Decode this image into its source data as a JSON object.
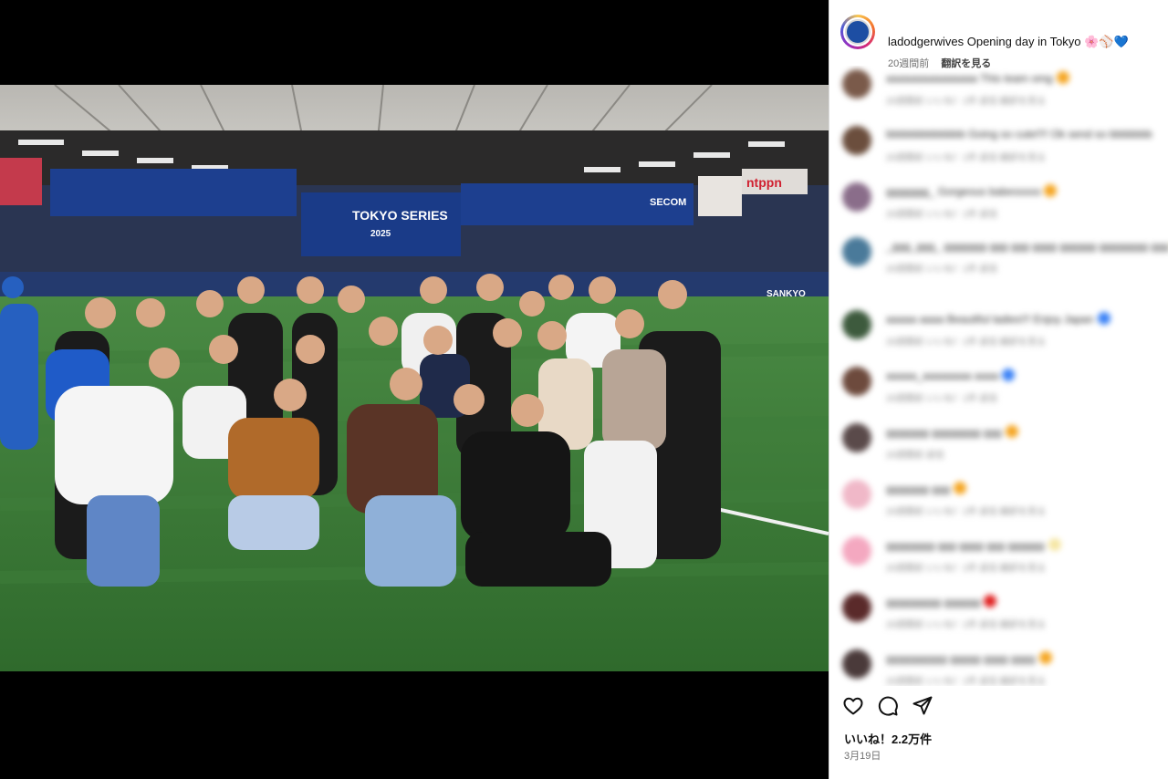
{
  "post": {
    "username": "ladodgerwives",
    "caption": "Opening day in Tokyo",
    "caption_emojis": "🌸⚾💙",
    "time_ago": "20週間前",
    "translate_label": "翻訳を見る"
  },
  "photo": {
    "alt_description_icon": "team-group-photo",
    "sponsor_boards": [
      "ntppn",
      "SECOM",
      "SANKYO"
    ],
    "scoreboard_title": "TOKYO SERIES",
    "scoreboard_year": "2025"
  },
  "comments": [
    {
      "text": "aaaaaaaaaaaaaaa This team omg",
      "sub": "20週間前   いいね！1件   返信   翻訳を見る",
      "color": "#7a5a4a",
      "emoji": "#f5a623"
    },
    {
      "text": "bbbbbbbbbbbbb Going so cute!!!! Ok send so bbbbbbb",
      "sub": "20週間前   いいね！1件   返信   翻訳を見る",
      "color": "#6b4e3d",
      "emoji": ""
    },
    {
      "text": "ggggggg_ Gorgeous babesssss",
      "sub": "20週間前   いいね！1件   返信",
      "color": "#8a6d8a",
      "emoji": "#f5a623"
    },
    {
      "text": "_ggg_ggg_ ggggggg ggg ggg gggg gggggg gggggggg ggg",
      "sub": "20週間前   いいね！1件   返信",
      "color": "#4a7a9a",
      "emoji": "#f5d623"
    },
    {
      "text": "aaaaa aaaa Beautiful ladies!!!   Enjoy Japan",
      "sub": "20週間前   いいね！1件   返信   翻訳を見る",
      "color": "#3d5a3d",
      "emoji": "#3b82f6"
    },
    {
      "text": "aaaaa_aaaaaaaa aaaa",
      "sub": "20週間前   いいね！1件   返信",
      "color": "#6d4a3d",
      "emoji": "#3b82f6"
    },
    {
      "text": "ggggggg gggggggg ggg",
      "sub": "20週間前   返信",
      "color": "#5a4a4a",
      "emoji": "#f5a623"
    },
    {
      "text": "ggggggg ggg",
      "sub": "20週間前   いいね！1件   返信   翻訳を見る",
      "color": "#f0b8c8",
      "emoji": "#f5a623"
    },
    {
      "text": "gggggggg ggg gggg ggg gggggg",
      "sub": "20週間前   いいね！1件   返信   翻訳を見る",
      "color": "#f4a8c0",
      "emoji": "#f5e6a3"
    },
    {
      "text": "ggggggggg gggggg",
      "sub": "20週間前   いいね！1件   返信   翻訳を見る",
      "color": "#5a2a2a",
      "emoji": "#e02020"
    },
    {
      "text": "gggggggggg ggggg gggg gggg",
      "sub": "20週間前   いいね！1件   返信   翻訳を見る",
      "color": "#4a3a3a",
      "emoji": "#f5a623"
    }
  ],
  "actions": {
    "like_icon": "heart-icon",
    "comment_icon": "comment-icon",
    "share_icon": "share-icon"
  },
  "likes_text": "いいね！2.2万件",
  "date_text": "3月19日"
}
